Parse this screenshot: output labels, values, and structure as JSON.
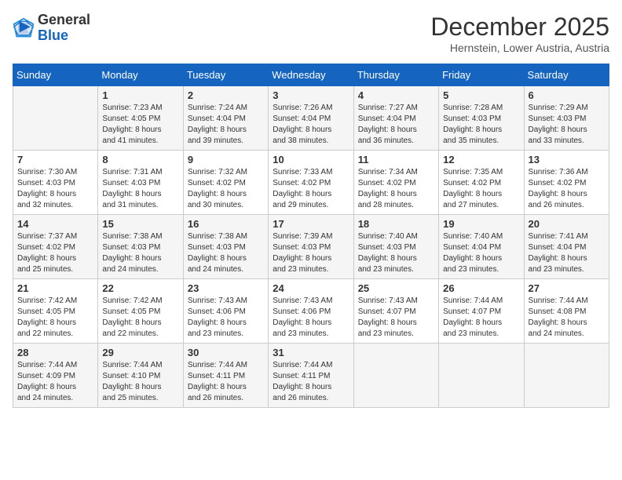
{
  "header": {
    "logo_general": "General",
    "logo_blue": "Blue",
    "month_title": "December 2025",
    "subtitle": "Hernstein, Lower Austria, Austria"
  },
  "days_of_week": [
    "Sunday",
    "Monday",
    "Tuesday",
    "Wednesday",
    "Thursday",
    "Friday",
    "Saturday"
  ],
  "weeks": [
    [
      {
        "day": "",
        "info": ""
      },
      {
        "day": "1",
        "info": "Sunrise: 7:23 AM\nSunset: 4:05 PM\nDaylight: 8 hours\nand 41 minutes."
      },
      {
        "day": "2",
        "info": "Sunrise: 7:24 AM\nSunset: 4:04 PM\nDaylight: 8 hours\nand 39 minutes."
      },
      {
        "day": "3",
        "info": "Sunrise: 7:26 AM\nSunset: 4:04 PM\nDaylight: 8 hours\nand 38 minutes."
      },
      {
        "day": "4",
        "info": "Sunrise: 7:27 AM\nSunset: 4:04 PM\nDaylight: 8 hours\nand 36 minutes."
      },
      {
        "day": "5",
        "info": "Sunrise: 7:28 AM\nSunset: 4:03 PM\nDaylight: 8 hours\nand 35 minutes."
      },
      {
        "day": "6",
        "info": "Sunrise: 7:29 AM\nSunset: 4:03 PM\nDaylight: 8 hours\nand 33 minutes."
      }
    ],
    [
      {
        "day": "7",
        "info": "Sunrise: 7:30 AM\nSunset: 4:03 PM\nDaylight: 8 hours\nand 32 minutes."
      },
      {
        "day": "8",
        "info": "Sunrise: 7:31 AM\nSunset: 4:03 PM\nDaylight: 8 hours\nand 31 minutes."
      },
      {
        "day": "9",
        "info": "Sunrise: 7:32 AM\nSunset: 4:02 PM\nDaylight: 8 hours\nand 30 minutes."
      },
      {
        "day": "10",
        "info": "Sunrise: 7:33 AM\nSunset: 4:02 PM\nDaylight: 8 hours\nand 29 minutes."
      },
      {
        "day": "11",
        "info": "Sunrise: 7:34 AM\nSunset: 4:02 PM\nDaylight: 8 hours\nand 28 minutes."
      },
      {
        "day": "12",
        "info": "Sunrise: 7:35 AM\nSunset: 4:02 PM\nDaylight: 8 hours\nand 27 minutes."
      },
      {
        "day": "13",
        "info": "Sunrise: 7:36 AM\nSunset: 4:02 PM\nDaylight: 8 hours\nand 26 minutes."
      }
    ],
    [
      {
        "day": "14",
        "info": "Sunrise: 7:37 AM\nSunset: 4:02 PM\nDaylight: 8 hours\nand 25 minutes."
      },
      {
        "day": "15",
        "info": "Sunrise: 7:38 AM\nSunset: 4:03 PM\nDaylight: 8 hours\nand 24 minutes."
      },
      {
        "day": "16",
        "info": "Sunrise: 7:38 AM\nSunset: 4:03 PM\nDaylight: 8 hours\nand 24 minutes."
      },
      {
        "day": "17",
        "info": "Sunrise: 7:39 AM\nSunset: 4:03 PM\nDaylight: 8 hours\nand 23 minutes."
      },
      {
        "day": "18",
        "info": "Sunrise: 7:40 AM\nSunset: 4:03 PM\nDaylight: 8 hours\nand 23 minutes."
      },
      {
        "day": "19",
        "info": "Sunrise: 7:40 AM\nSunset: 4:04 PM\nDaylight: 8 hours\nand 23 minutes."
      },
      {
        "day": "20",
        "info": "Sunrise: 7:41 AM\nSunset: 4:04 PM\nDaylight: 8 hours\nand 23 minutes."
      }
    ],
    [
      {
        "day": "21",
        "info": "Sunrise: 7:42 AM\nSunset: 4:05 PM\nDaylight: 8 hours\nand 22 minutes."
      },
      {
        "day": "22",
        "info": "Sunrise: 7:42 AM\nSunset: 4:05 PM\nDaylight: 8 hours\nand 22 minutes."
      },
      {
        "day": "23",
        "info": "Sunrise: 7:43 AM\nSunset: 4:06 PM\nDaylight: 8 hours\nand 23 minutes."
      },
      {
        "day": "24",
        "info": "Sunrise: 7:43 AM\nSunset: 4:06 PM\nDaylight: 8 hours\nand 23 minutes."
      },
      {
        "day": "25",
        "info": "Sunrise: 7:43 AM\nSunset: 4:07 PM\nDaylight: 8 hours\nand 23 minutes."
      },
      {
        "day": "26",
        "info": "Sunrise: 7:44 AM\nSunset: 4:07 PM\nDaylight: 8 hours\nand 23 minutes."
      },
      {
        "day": "27",
        "info": "Sunrise: 7:44 AM\nSunset: 4:08 PM\nDaylight: 8 hours\nand 24 minutes."
      }
    ],
    [
      {
        "day": "28",
        "info": "Sunrise: 7:44 AM\nSunset: 4:09 PM\nDaylight: 8 hours\nand 24 minutes."
      },
      {
        "day": "29",
        "info": "Sunrise: 7:44 AM\nSunset: 4:10 PM\nDaylight: 8 hours\nand 25 minutes."
      },
      {
        "day": "30",
        "info": "Sunrise: 7:44 AM\nSunset: 4:11 PM\nDaylight: 8 hours\nand 26 minutes."
      },
      {
        "day": "31",
        "info": "Sunrise: 7:44 AM\nSunset: 4:11 PM\nDaylight: 8 hours\nand 26 minutes."
      },
      {
        "day": "",
        "info": ""
      },
      {
        "day": "",
        "info": ""
      },
      {
        "day": "",
        "info": ""
      }
    ]
  ]
}
